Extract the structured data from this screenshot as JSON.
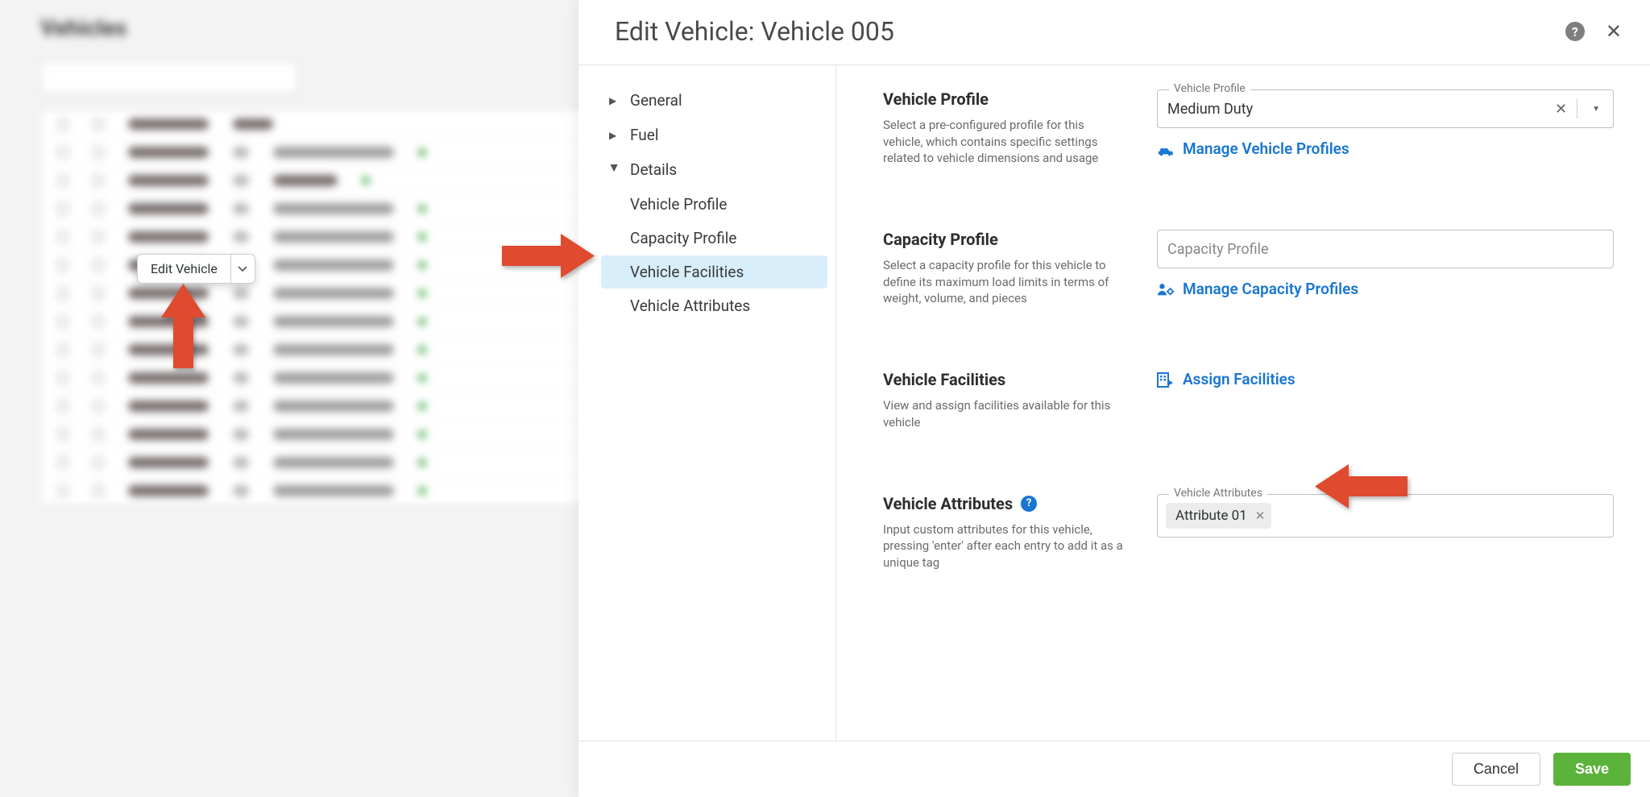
{
  "bg": {
    "page_title": "Vehicles",
    "popover_label": "Edit Vehicle"
  },
  "modal": {
    "title": "Edit Vehicle: Vehicle 005",
    "sidebar": {
      "general": "General",
      "fuel": "Fuel",
      "details": "Details",
      "sub": {
        "vehicle_profile": "Vehicle Profile",
        "capacity_profile": "Capacity Profile",
        "vehicle_facilities": "Vehicle Facilities",
        "vehicle_attributes": "Vehicle Attributes"
      }
    },
    "sections": {
      "vehicle_profile": {
        "heading": "Vehicle Profile",
        "desc": "Select a pre-configured profile for this vehicle, which contains specific settings related to vehicle dimensions and usage",
        "field_label": "Vehicle Profile",
        "field_value": "Medium Duty",
        "link": "Manage Vehicle Profiles"
      },
      "capacity_profile": {
        "heading": "Capacity Profile",
        "desc": "Select a capacity profile for this vehicle to define its maximum load limits in terms of weight, volume, and pieces",
        "field_label": "Capacity Profile",
        "field_placeholder": "Capacity Profile",
        "link": "Manage Capacity Profiles"
      },
      "vehicle_facilities": {
        "heading": "Vehicle Facilities",
        "desc": "View and assign facilities available for this vehicle",
        "link": "Assign Facilities"
      },
      "vehicle_attributes": {
        "heading": "Vehicle Attributes",
        "desc": "Input custom attributes for this vehicle, pressing 'enter' after each entry to add it as a unique tag",
        "field_label": "Vehicle Attributes",
        "chip": "Attribute 01"
      }
    },
    "footer": {
      "cancel": "Cancel",
      "save": "Save"
    }
  }
}
